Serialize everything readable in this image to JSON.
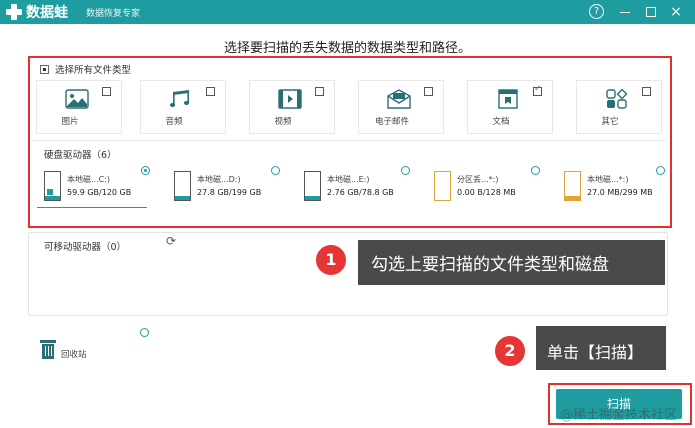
{
  "titlebar": {
    "app_name": "数据蛙",
    "subtitle": "数据恢复专家",
    "help_label": "?",
    "close_label": "×"
  },
  "heading": "选择要扫描的丢失数据的数据类型和路径。",
  "file_types": {
    "select_all_label": "选择所有文件类型",
    "items": [
      {
        "label": "图片",
        "icon": "image-icon",
        "checked": false
      },
      {
        "label": "音频",
        "icon": "music-icon",
        "checked": false
      },
      {
        "label": "视频",
        "icon": "video-icon",
        "checked": false
      },
      {
        "label": "电子邮件",
        "icon": "email-icon",
        "checked": false
      },
      {
        "label": "文档",
        "icon": "document-icon",
        "checked": true
      },
      {
        "label": "其它",
        "icon": "other-icon",
        "checked": false
      }
    ]
  },
  "hard_drives": {
    "title": "硬盘驱动器（6）",
    "drives": [
      {
        "name": "本地磁...C:)",
        "size": "59.9 GB/120 GB",
        "selected": true,
        "kind": "system"
      },
      {
        "name": "本地磁...D:)",
        "size": "27.8 GB/199 GB",
        "selected": false,
        "kind": "disk"
      },
      {
        "name": "本地磁...E:)",
        "size": "2.76 GB/78.8 GB",
        "selected": false,
        "kind": "disk"
      },
      {
        "name": "分区丢...*:)",
        "size": "0.00  B/128 MB",
        "selected": false,
        "kind": "usb"
      },
      {
        "name": "本地磁...*:)",
        "size": "27.0 MB/299 MB",
        "selected": false,
        "kind": "usb"
      }
    ]
  },
  "removable": {
    "title": "可移动驱动器（0）"
  },
  "recycle_bin": {
    "label": "回收站"
  },
  "callouts": [
    {
      "number": "1",
      "text": "勾选上要扫描的文件类型和磁盘"
    },
    {
      "number": "2",
      "text": "单击【扫描】"
    }
  ],
  "scan_button": "扫描",
  "watermark": "@稀土掘金技术社区",
  "colors": {
    "accent": "#1f9ca0",
    "highlight_red": "#e03030",
    "badge_red": "#e53535",
    "callout_bg": "#4a4a4a"
  }
}
